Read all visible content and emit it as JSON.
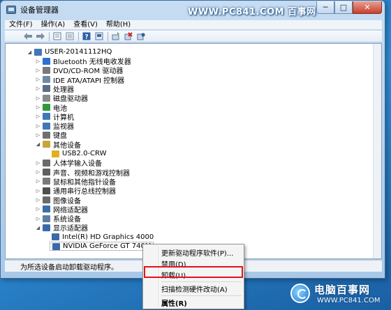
{
  "window": {
    "title": "设备管理器",
    "watermark": "WWW.PC841.COM 百事网",
    "controls": {
      "minimize": "─",
      "maximize": "□",
      "close": "✕"
    }
  },
  "menu": [
    "文件(F)",
    "操作(A)",
    "查看(V)",
    "帮助(H)"
  ],
  "toolbar_icons": [
    "back-arrow-icon",
    "forward-arrow-icon",
    "properties-icon",
    "show-hidden-icon",
    "help-icon",
    "update-driver-icon",
    "scan-hardware-icon",
    "uninstall-device-icon",
    "disable-device-icon"
  ],
  "tree": {
    "root": "USER-20141112HQ",
    "categories": [
      {
        "label": "Bluetooth 无线电收发器",
        "icon": "bluetooth-icon",
        "color": "#2f6fd0"
      },
      {
        "label": "DVD/CD-ROM 驱动器",
        "icon": "dvd-drive-icon",
        "color": "#7a7a7a"
      },
      {
        "label": "IDE ATA/ATAPI 控制器",
        "icon": "ide-controller-icon",
        "color": "#6f8aa6"
      },
      {
        "label": "处理器",
        "icon": "processor-icon",
        "color": "#5b6f85"
      },
      {
        "label": "磁盘驱动器",
        "icon": "disk-drive-icon",
        "color": "#8a8a8a"
      },
      {
        "label": "电池",
        "icon": "battery-icon",
        "color": "#2f9a3a"
      },
      {
        "label": "计算机",
        "icon": "computer-icon",
        "color": "#3f78b8"
      },
      {
        "label": "监视器",
        "icon": "monitor-icon",
        "color": "#3f78b8"
      },
      {
        "label": "键盘",
        "icon": "keyboard-icon",
        "color": "#707070"
      },
      {
        "label": "其他设备",
        "icon": "other-devices-icon",
        "color": "#c9a43a",
        "expanded": true,
        "children": [
          {
            "label": "USB2.0-CRW",
            "icon": "unknown-device-warning-icon",
            "color": "#e0b020"
          }
        ]
      },
      {
        "label": "人体学输入设备",
        "icon": "hid-icon",
        "color": "#6b6b6b"
      },
      {
        "label": "声音、视频和游戏控制器",
        "icon": "sound-icon",
        "color": "#5f5f5f"
      },
      {
        "label": "鼠标和其他指针设备",
        "icon": "mouse-icon",
        "color": "#7a7a7a"
      },
      {
        "label": "通用串行总线控制器",
        "icon": "usb-controller-icon",
        "color": "#4f4f4f"
      },
      {
        "label": "图像设备",
        "icon": "imaging-device-icon",
        "color": "#6a6a6a"
      },
      {
        "label": "网络适配器",
        "icon": "network-adapter-icon",
        "color": "#3d6ea6"
      },
      {
        "label": "系统设备",
        "icon": "system-device-icon",
        "color": "#5d7fa5"
      },
      {
        "label": "显示适配器",
        "icon": "display-adapter-icon",
        "color": "#3a6ba8",
        "expanded": true,
        "children": [
          {
            "label": "Intel(R) HD Graphics 4000",
            "icon": "display-card-icon",
            "color": "#3a6ba8"
          },
          {
            "label": "NVIDIA GeForce GT 740M",
            "icon": "display-card-icon",
            "color": "#3a6ba8",
            "selected": true
          }
        ]
      }
    ]
  },
  "status": "为所选设备启动卸载驱动程序。",
  "context_menu": {
    "items": [
      "更新驱动程序软件(P)...",
      "禁用(D)",
      "卸载(U)",
      "扫描检测硬件改动(A)",
      "属性(R)"
    ],
    "highlighted": "卸载(U)",
    "bold": "属性(R)"
  },
  "logo": {
    "text": "电脑百事网",
    "url": "WWW.PC841.COM"
  }
}
